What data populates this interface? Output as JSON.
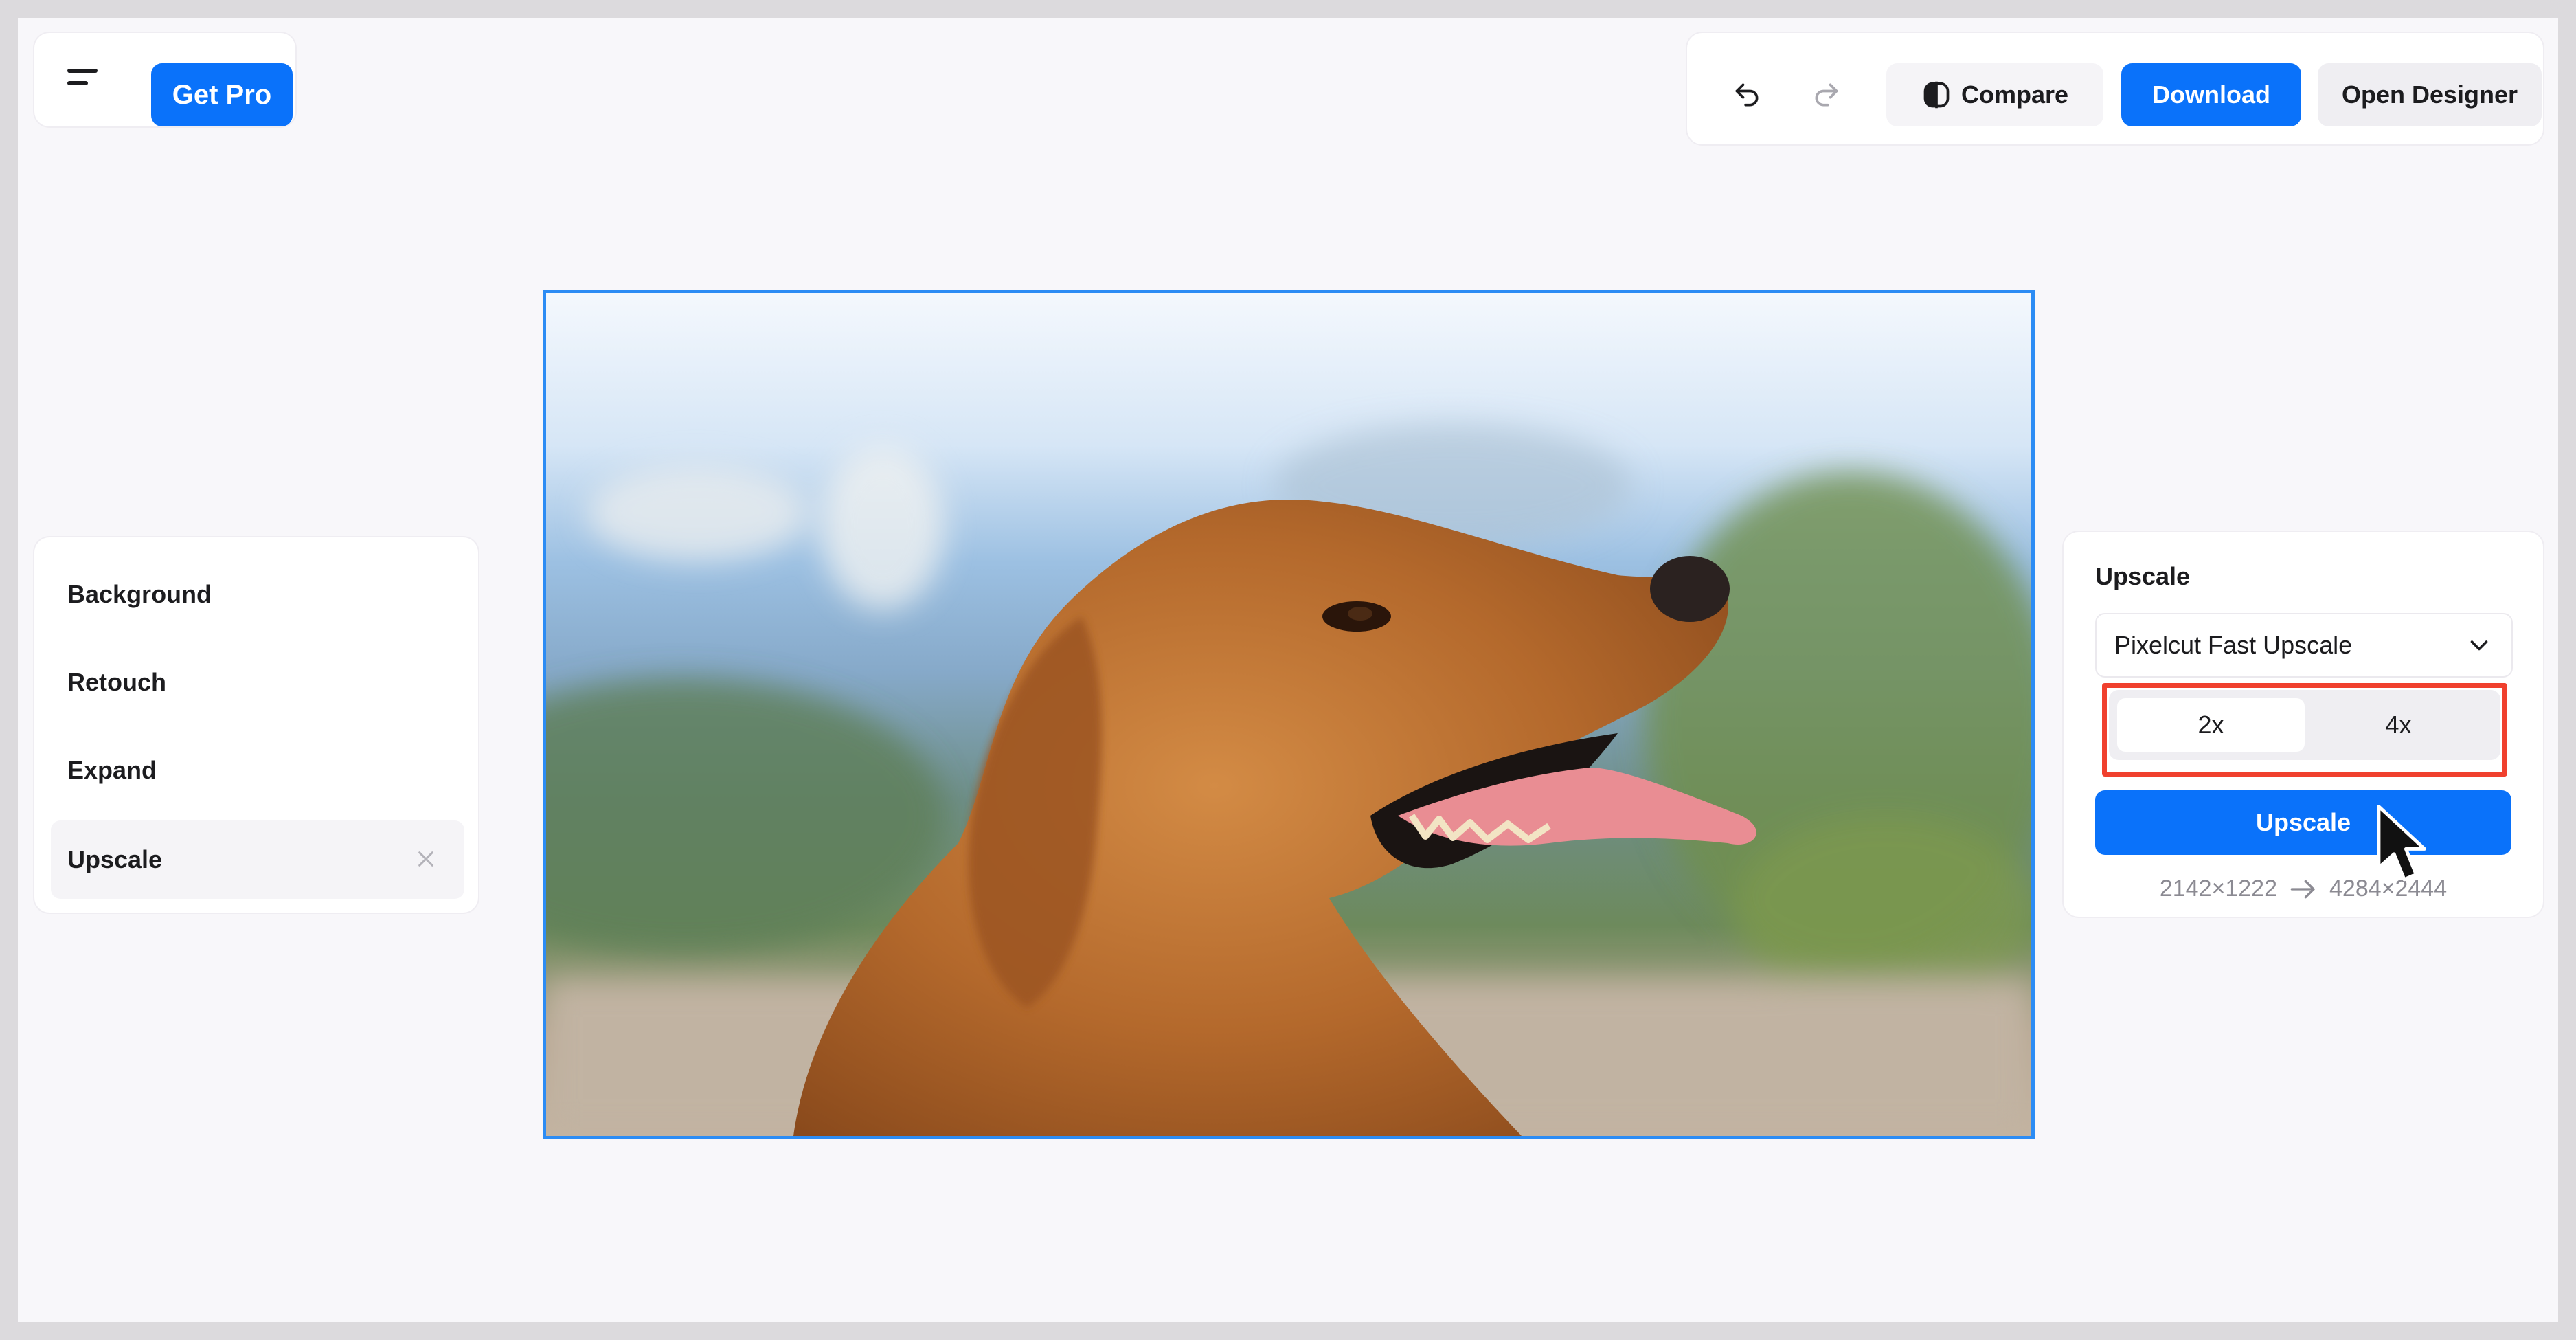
{
  "topbar": {
    "get_pro_label": "Get Pro",
    "compare_label": "Compare",
    "download_label": "Download",
    "open_designer_label": "Open Designer"
  },
  "sidebar": {
    "items": [
      {
        "label": "Background"
      },
      {
        "label": "Retouch"
      },
      {
        "label": "Expand"
      },
      {
        "label": "Upscale",
        "active": true
      }
    ]
  },
  "upscale_panel": {
    "title": "Upscale",
    "model": "Pixelcut Fast Upscale",
    "scale_options": [
      "2x",
      "4x"
    ],
    "selected_scale": "2x",
    "button_label": "Upscale",
    "source_dims": "2142×1222",
    "arrow": "→",
    "target_dims": "4284×2444"
  },
  "colors": {
    "accent": "#0a72fa",
    "highlight": "#f0402e",
    "canvas_border": "#2c8cf4"
  },
  "icons": [
    "menu-icon",
    "undo-icon",
    "redo-icon",
    "compare-icon",
    "close-icon",
    "chevron-down-icon",
    "arrow-right-icon",
    "pointer-cursor-icon"
  ]
}
